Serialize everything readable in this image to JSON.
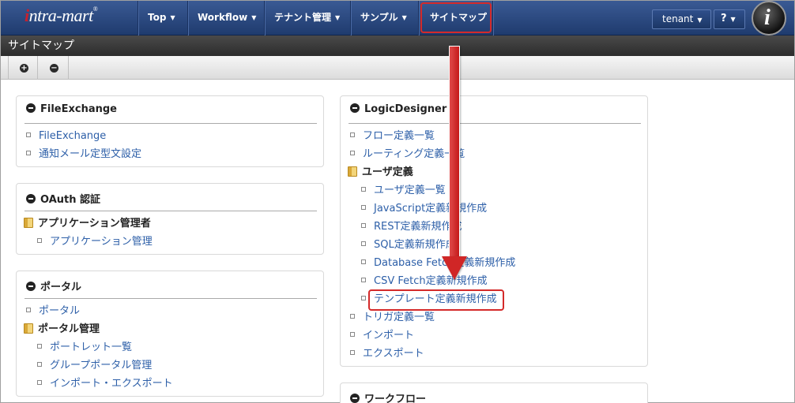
{
  "navbar": {
    "logo_text": "intra-mart",
    "logo_mark": "®",
    "items": [
      {
        "label": "Top"
      },
      {
        "label": "Workflow"
      },
      {
        "label": "テナント管理"
      },
      {
        "label": "サンプル"
      },
      {
        "label": "サイトマップ"
      }
    ],
    "tenant_label": "tenant",
    "help_label": "?",
    "avatar_letter": "i",
    "accent_color": "#1f3b6e",
    "highlight_color": "#d42a2a"
  },
  "page": {
    "title": "サイトマップ",
    "toolbar": {
      "expand_icon": "plus-circle-icon",
      "collapse_icon": "minus-circle-icon"
    }
  },
  "panels": {
    "file_exchange": {
      "title": "FileExchange",
      "items": [
        "FileExchange",
        "通知メール定型文設定"
      ]
    },
    "oauth": {
      "title": "OAuth 認証",
      "group": "アプリケーション管理者",
      "items": [
        "アプリケーション管理"
      ]
    },
    "portal": {
      "title": "ポータル",
      "item": "ポータル",
      "group": "ポータル管理",
      "group_items": [
        "ポートレット一覧",
        "グループポータル管理",
        "インポート・エクスポート"
      ]
    },
    "logic_designer": {
      "title": "LogicDesigner",
      "items_top": [
        "フロー定義一覧",
        "ルーティング定義一覧"
      ],
      "group": "ユーザ定義",
      "group_items": [
        "ユーザ定義一覧",
        "JavaScript定義新規作成",
        "REST定義新規作成",
        "SQL定義新規作成",
        "Database Fetch定義新規作成",
        "CSV Fetch定義新規作成",
        "テンプレート定義新規作成"
      ],
      "items_bottom": [
        "トリガ定義一覧",
        "インポート",
        "エクスポート"
      ]
    },
    "workflow": {
      "title": "ワークフロー"
    }
  }
}
